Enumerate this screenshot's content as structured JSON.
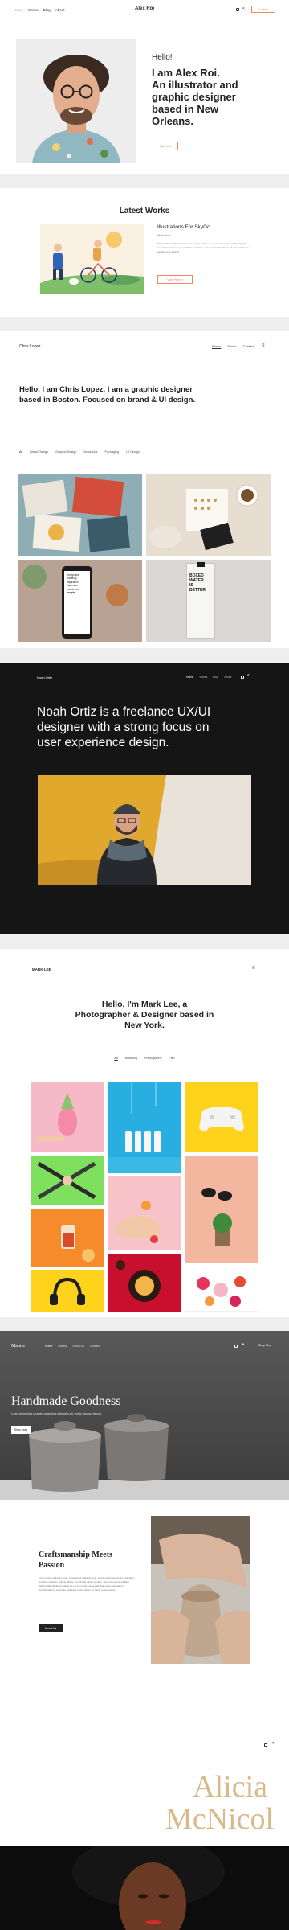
{
  "s1": {
    "nav": [
      "Home",
      "Works",
      "Blog",
      "About"
    ],
    "brand": "Alex Roi",
    "contact": "Contact",
    "greeting": "Hello!",
    "headline": [
      "I am Alex Roi.",
      "An illustrator and",
      "graphic designer",
      "based in New",
      "Orleans."
    ],
    "cta": "Say Hello"
  },
  "s2": {
    "title": "Latest Works",
    "project_title": "Illustrations For SkyGo",
    "project_tag": "Illustration",
    "description": "Suspendisse facilisis lorem. Lorem ipsum dolor sit amet, consectetur adipiscing elit, sed do eiusmod tempor incididunt ut labore et dolore magna aliqua. Ut enim ad minim veniam quis nostrud.",
    "cta": "View Project"
  },
  "s3": {
    "brand": "Chris Lopez",
    "nav": [
      "Works",
      "Studio",
      "Contact"
    ],
    "headline": [
      "Hello, I am Chris Lopez. I am a graphic designer",
      "based in Boston. Focused on brand & UI design."
    ],
    "filters": [
      "All",
      "Brand Design",
      "Graphic Design",
      "Mock-Ups",
      "Packaging",
      "UI Design"
    ],
    "phone_text": [
      "Design and",
      "branding",
      "inspiration",
      "that make",
      "people love",
      "people"
    ],
    "carton_text": [
      "BOXED",
      "WATER",
      "IS",
      "BETTER"
    ]
  },
  "s4": {
    "brand": "Noah Ortiz",
    "nav": [
      "Home",
      "Works",
      "Blog",
      "About"
    ],
    "headline": [
      "Noah Ortiz is a freelance UX/UI",
      "designer with a strong focus on",
      "user experience design."
    ]
  },
  "s5": {
    "brand": "MARK LEE",
    "headline": [
      "Hello, I'm Mark Lee, a",
      "Photographer & Designer based in",
      "New York."
    ],
    "filters": [
      "All",
      "Branding",
      "Photography",
      "Film"
    ]
  },
  "s6": {
    "brand": "Mantle",
    "nav": [
      "Home",
      "Gallery",
      "About Us",
      "Contact"
    ],
    "cta_top": "Shop Now",
    "title": "Handmade Goodness",
    "subtitle": "Lorem ipsum dolor sit amet, consectetur adipiscing elit, sed do eiusmod tempor.",
    "hero_btn": "Shop Now",
    "craft_title": [
      "Craftsmanship Meets",
      "Passion"
    ],
    "craft_body": "Lorem ipsum dolor sit amet, consectetur adipiscing elit, sed do eiusmod tempor incididunt ut labore et dolore magna aliqua. Ut enim ad minim veniam, quis nostrud exercitation ullamco laboris nisi ut aliquip ex ea commodo consequat. Duis aute irure dolor in reprehenderit in voluptate velit esse cillum dolore eu fugiat nulla pariatur.",
    "craft_btn": "About Us"
  },
  "s7": {
    "name": [
      "Alicia",
      "McNicol"
    ]
  },
  "colors": {
    "accent": "#f08a5d",
    "gold": "#d9b98a"
  }
}
